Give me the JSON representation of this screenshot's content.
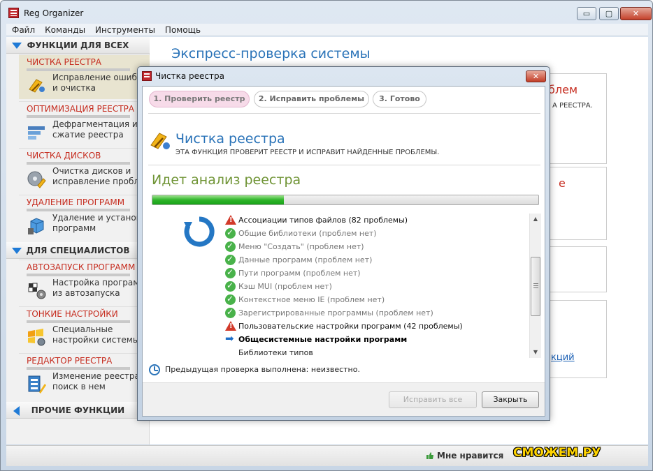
{
  "window": {
    "title": "Reg Organizer",
    "controls": {
      "minimize": "▭",
      "maximize": "▢",
      "close": "✕"
    }
  },
  "menu": [
    "Файл",
    "Команды",
    "Инструменты",
    "Помощь"
  ],
  "sidebar": {
    "sections": [
      {
        "label": "ФУНКЦИИ ДЛЯ ВСЕХ"
      },
      {
        "label": "ДЛЯ СПЕЦИАЛИСТОВ"
      },
      {
        "label": "ПРОЧИЕ ФУНКЦИИ"
      }
    ],
    "items": [
      {
        "category": "ЧИСТКА РЕЕСТРА",
        "line1": "Исправление ошибок",
        "line2": "и очистка",
        "icon": "registry-clean-icon"
      },
      {
        "category": "ОПТИМИЗАЦИЯ РЕЕСТРА",
        "line1": "Дефрагментация и",
        "line2": "сжатие реестра",
        "icon": "defrag-icon"
      },
      {
        "category": "ЧИСТКА ДИСКОВ",
        "line1": "Очистка дисков и",
        "line2": "исправление проблем",
        "icon": "disk-clean-icon"
      },
      {
        "category": "УДАЛЕНИЕ ПРОГРАММ",
        "line1": "Удаление и установка",
        "line2": "программ",
        "icon": "uninstall-icon"
      },
      {
        "category": "АВТОЗАПУСК ПРОГРАММ",
        "line1": "Настройка программ",
        "line2": "из автозапуска",
        "icon": "autorun-icon"
      },
      {
        "category": "ТОНКИЕ НАСТРОЙКИ",
        "line1": "Специальные",
        "line2": "настройки системы",
        "icon": "tweaks-icon"
      },
      {
        "category": "РЕДАКТОР РЕЕСТРА",
        "line1": "Изменение реестра и",
        "line2": "поиск в нем",
        "icon": "regedit-icon"
      }
    ]
  },
  "main": {
    "title": "Экспресс-проверка системы",
    "bg_fragments": {
      "red1": "блем",
      "small1": "А РЕЕСТРА.",
      "red2": "е",
      "link": "кций"
    }
  },
  "statusbar": {
    "like": "Мне нравится",
    "watermark": "СМОЖЕМ.РУ"
  },
  "dialog": {
    "title": "Чистка реестра",
    "close": "✕",
    "steps": [
      "1. Проверить реестр",
      "2. Исправить проблемы",
      "3. Готово"
    ],
    "heading": "Чистка реестра",
    "description": "ЭТА ФУНКЦИЯ ПРОВЕРИТ РЕЕСТР И ИСПРАВИТ НАЙДЕННЫЕ ПРОБЛЕМЫ.",
    "analysis_label": "Идет анализ реестра",
    "progress": 0.34,
    "checks": [
      {
        "status": "warn",
        "text": "Ассоциации типов файлов (82 проблемы)"
      },
      {
        "status": "ok",
        "text": "Общие библиотеки (проблем нет)"
      },
      {
        "status": "ok",
        "text": "Меню \"Создать\" (проблем нет)"
      },
      {
        "status": "ok",
        "text": "Данные программ (проблем нет)"
      },
      {
        "status": "ok",
        "text": "Пути программ (проблем нет)"
      },
      {
        "status": "ok",
        "text": "Кэш MUI (проблем нет)"
      },
      {
        "status": "ok",
        "text": "Контекстное меню IE (проблем нет)"
      },
      {
        "status": "ok",
        "text": "Зарегистрированные программы (проблем нет)"
      },
      {
        "status": "warn",
        "text": "Пользовательские настройки программ (42 проблемы)"
      },
      {
        "status": "current",
        "text": "Общесистемные настройки программ"
      },
      {
        "status": "pending",
        "text": "Библиотеки типов"
      }
    ],
    "previous_check": "Предыдущая проверка выполнена: неизвестно.",
    "buttons": {
      "fix_all": "Исправить все",
      "close": "Закрыть"
    }
  }
}
